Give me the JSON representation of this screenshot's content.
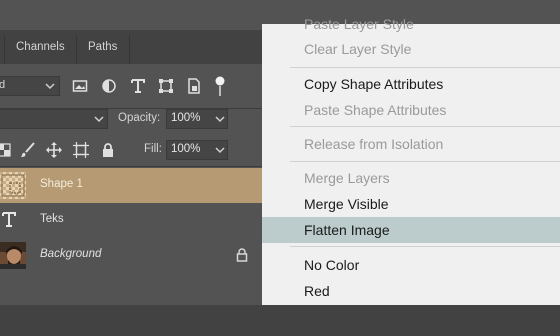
{
  "tabs": {
    "channels": "Channels",
    "paths": "Paths"
  },
  "toolbar": {
    "opacity_label": "Opacity:",
    "opacity_value": "100%",
    "fill_label": "Fill:",
    "fill_value": "100%"
  },
  "layers": [
    {
      "name": "Shape 1",
      "selected": true
    },
    {
      "name": "Teks",
      "selected": false
    },
    {
      "name": "Background",
      "selected": false,
      "locked": true
    }
  ],
  "context_menu": {
    "items": [
      {
        "label": "Paste Layer Style",
        "enabled": false
      },
      {
        "label": "Clear Layer Style",
        "enabled": false
      },
      {
        "label": "Copy Shape Attributes",
        "enabled": true
      },
      {
        "label": "Paste Shape Attributes",
        "enabled": false
      },
      {
        "label": "Release from Isolation",
        "enabled": false
      },
      {
        "label": "Merge Layers",
        "enabled": false
      },
      {
        "label": "Merge Visible",
        "enabled": true
      },
      {
        "label": "Flatten Image",
        "enabled": true,
        "highlighted": true
      },
      {
        "label": "No Color",
        "enabled": true
      },
      {
        "label": "Red",
        "enabled": true
      }
    ]
  },
  "colors": {
    "panel_bg": "#535353",
    "selected_layer": "#b59a73",
    "menu_bg": "#f0f0f0",
    "menu_highlight": "#bccbcb"
  }
}
